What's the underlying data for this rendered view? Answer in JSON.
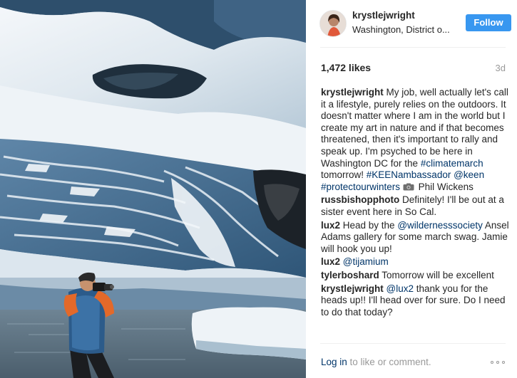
{
  "post": {
    "username": "krystlejwright",
    "location": "Washington, District o...",
    "follow_label": "Follow",
    "likes": "1,472 likes",
    "age": "3d"
  },
  "caption": {
    "user": "krystlejwright",
    "text_1": " My job, well actually let's call it a lifestyle, purely relies on the outdoors. It doesn't matter where I am in the world but I create my art in nature and if that becomes threatened, then it's important to rally and speak up. I'm psyched to be here in Washington DC for the ",
    "hashtag_1": "#climatemarch",
    "text_2": " tomorrow! ",
    "hashtag_2": "#KEENambassador",
    "text_3": " ",
    "mention_1": "@keen",
    "text_4": " ",
    "hashtag_3": "#protectourwinters",
    "text_5": " Phil Wickens"
  },
  "comments": [
    {
      "user": "russbishopphoto",
      "text": " Definitely! I'll be out at a sister event here in So Cal."
    },
    {
      "user": "lux2",
      "pre": " Head by the ",
      "mention": "@wildernesssociety",
      "post": " Ansel Adams gallery for some march swag. Jamie will hook you up!"
    },
    {
      "user": "lux2",
      "pre": " ",
      "mention": "@tijamium",
      "post": ""
    },
    {
      "user": "tylerboshard",
      "text": " Tomorrow will be excellent"
    },
    {
      "user": "krystlejwright",
      "pre": " ",
      "mention": "@lux2",
      "post": " thank you for the heads up!! I'll head over for sure. Do I need to do that today?"
    }
  ],
  "footer": {
    "login_label": "Log in",
    "login_suffix": " to like or comment."
  },
  "icons": {
    "camera": "camera-icon",
    "more": "more-options-icon"
  },
  "colors": {
    "accent": "#3897f0",
    "link": "#003569",
    "muted": "#999999"
  }
}
